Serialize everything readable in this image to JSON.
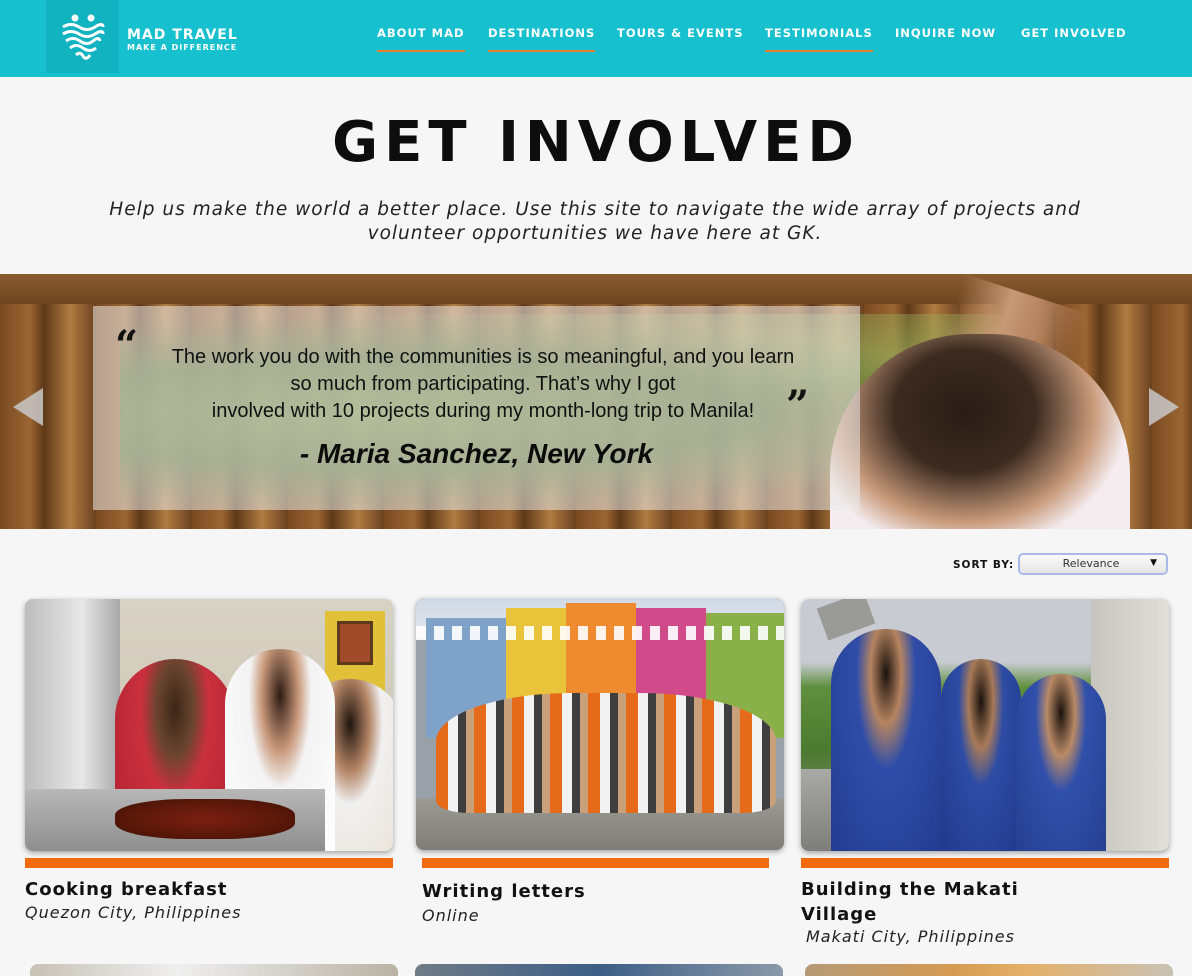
{
  "header": {
    "logo_name": "MAD TRAVEL",
    "logo_tagline": "MAKE A DIFFERENCE",
    "logo_icon": "heart-waves-icon",
    "nav": [
      {
        "label": "ABOUT MAD",
        "underlined": true
      },
      {
        "label": "DESTINATIONS",
        "underlined": true
      },
      {
        "label": "TOURS & EVENTS",
        "underlined": false
      },
      {
        "label": "TESTIMONIALS",
        "underlined": true
      },
      {
        "label": "INQUIRE NOW",
        "underlined": false
      },
      {
        "label": "GET INVOLVED",
        "underlined": false
      }
    ]
  },
  "intro": {
    "title": "GET INVOLVED",
    "subtitle": "Help us make the world a better place.  Use this site to navigate the wide array of projects and volunteer opportunities we have here at GK."
  },
  "hero": {
    "quote_open": "“",
    "quote_close": "”",
    "quote_lines": [
      "The work you do with the communities is so meaningful, and you learn",
      "so much from participating. That’s why I got",
      "involved with 10 projects during my month-long trip to Manila!"
    ],
    "author": "- Maria Sanchez, New York",
    "prev_icon": "triangle-left-icon",
    "next_icon": "triangle-right-icon"
  },
  "sort": {
    "label": "SORT BY:",
    "value": "Relevance",
    "caret": "▼"
  },
  "cards": [
    {
      "title": "Cooking breakfast",
      "location": "Quezon City, Philippines"
    },
    {
      "title": "Writing letters",
      "location": "Online"
    },
    {
      "title": "Building the Makati Village",
      "location": "Makati City, Philippines"
    }
  ],
  "colors": {
    "header_bg": "#17c0cf",
    "accent_orange": "#f26a10",
    "nav_underline": "#f07f2a"
  }
}
